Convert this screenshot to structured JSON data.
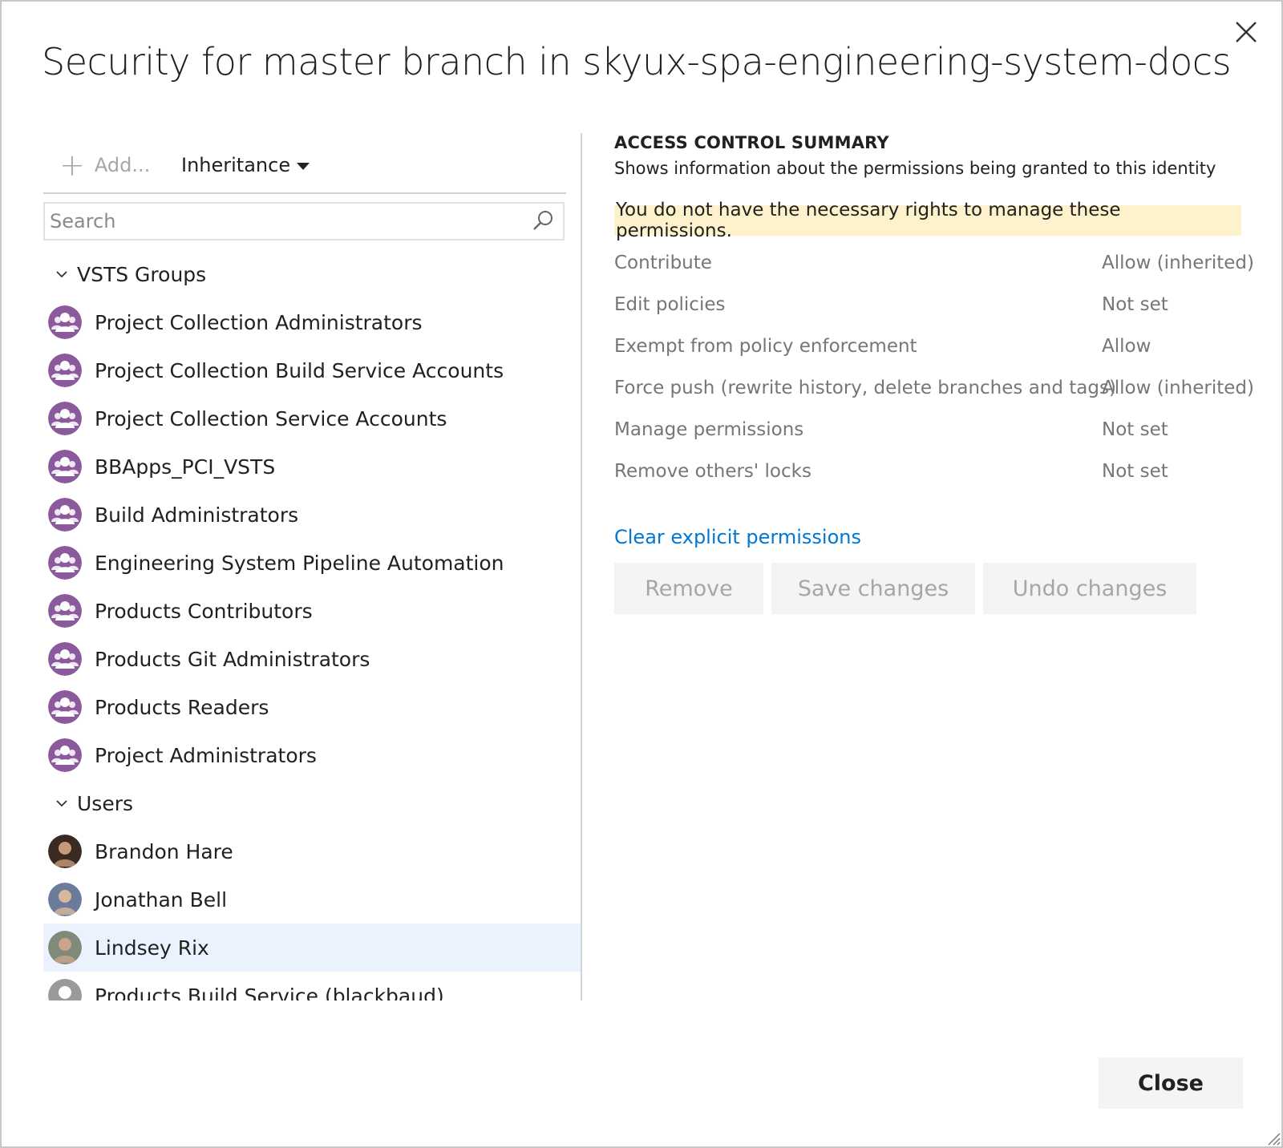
{
  "dialog": {
    "title": "Security for master branch in skyux-spa-engineering-system-docs",
    "close_button": "Close"
  },
  "toolbar": {
    "add_label": "Add...",
    "inheritance_label": "Inheritance"
  },
  "search": {
    "placeholder": "Search",
    "value": ""
  },
  "tree": {
    "groups_header": "VSTS Groups",
    "groups": [
      "Project Collection Administrators",
      "Project Collection Build Service Accounts",
      "Project Collection Service Accounts",
      "BBApps_PCI_VSTS",
      "Build Administrators",
      "Engineering System Pipeline Automation",
      "Products Contributors",
      "Products Git Administrators",
      "Products Readers",
      "Project Administrators"
    ],
    "users_header": "Users",
    "users": [
      {
        "name": "Brandon Hare",
        "selected": false
      },
      {
        "name": "Jonathan Bell",
        "selected": false
      },
      {
        "name": "Lindsey Rix",
        "selected": true
      },
      {
        "name": "Products Build Service (blackbaud)",
        "selected": false
      }
    ]
  },
  "summary": {
    "title": "ACCESS CONTROL SUMMARY",
    "description": "Shows information about the permissions being granted to this identity",
    "warning": "You do not have the necessary rights to manage these permissions.",
    "permissions": [
      {
        "name": "Contribute",
        "value": "Allow (inherited)"
      },
      {
        "name": "Edit policies",
        "value": "Not set"
      },
      {
        "name": "Exempt from policy enforcement",
        "value": "Allow"
      },
      {
        "name": "Force push (rewrite history, delete branches and tags)",
        "value": "Allow (inherited)"
      },
      {
        "name": "Manage permissions",
        "value": "Not set"
      },
      {
        "name": "Remove others' locks",
        "value": "Not set"
      }
    ],
    "clear_link": "Clear explicit permissions",
    "buttons": {
      "remove": "Remove",
      "save": "Save changes",
      "undo": "Undo changes"
    }
  },
  "colors": {
    "group_avatar": "#8a5a9c",
    "warning_bg": "#fdf2cc",
    "link": "#0078d4",
    "selected_row": "#eaf3fd"
  }
}
